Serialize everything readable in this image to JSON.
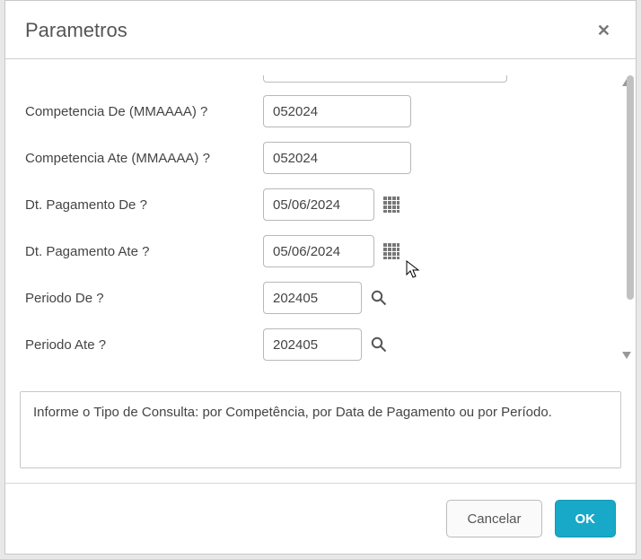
{
  "dialog": {
    "title": "Parametros"
  },
  "fields": {
    "competencia_de": {
      "label": "Competencia De (MMAAAA) ?",
      "value": "052024"
    },
    "competencia_ate": {
      "label": "Competencia Ate (MMAAAA) ?",
      "value": "052024"
    },
    "dt_pagamento_de": {
      "label": "Dt. Pagamento De ?",
      "value": "05/06/2024"
    },
    "dt_pagamento_ate": {
      "label": "Dt. Pagamento Ate ?",
      "value": "05/06/2024"
    },
    "periodo_de": {
      "label": "Periodo De ?",
      "value": "202405"
    },
    "periodo_ate": {
      "label": "Periodo Ate ?",
      "value": "202405"
    }
  },
  "help": {
    "text": "Informe o Tipo de Consulta: por Competência, por Data de Pagamento ou por Período."
  },
  "footer": {
    "cancel": "Cancelar",
    "ok": "OK"
  }
}
